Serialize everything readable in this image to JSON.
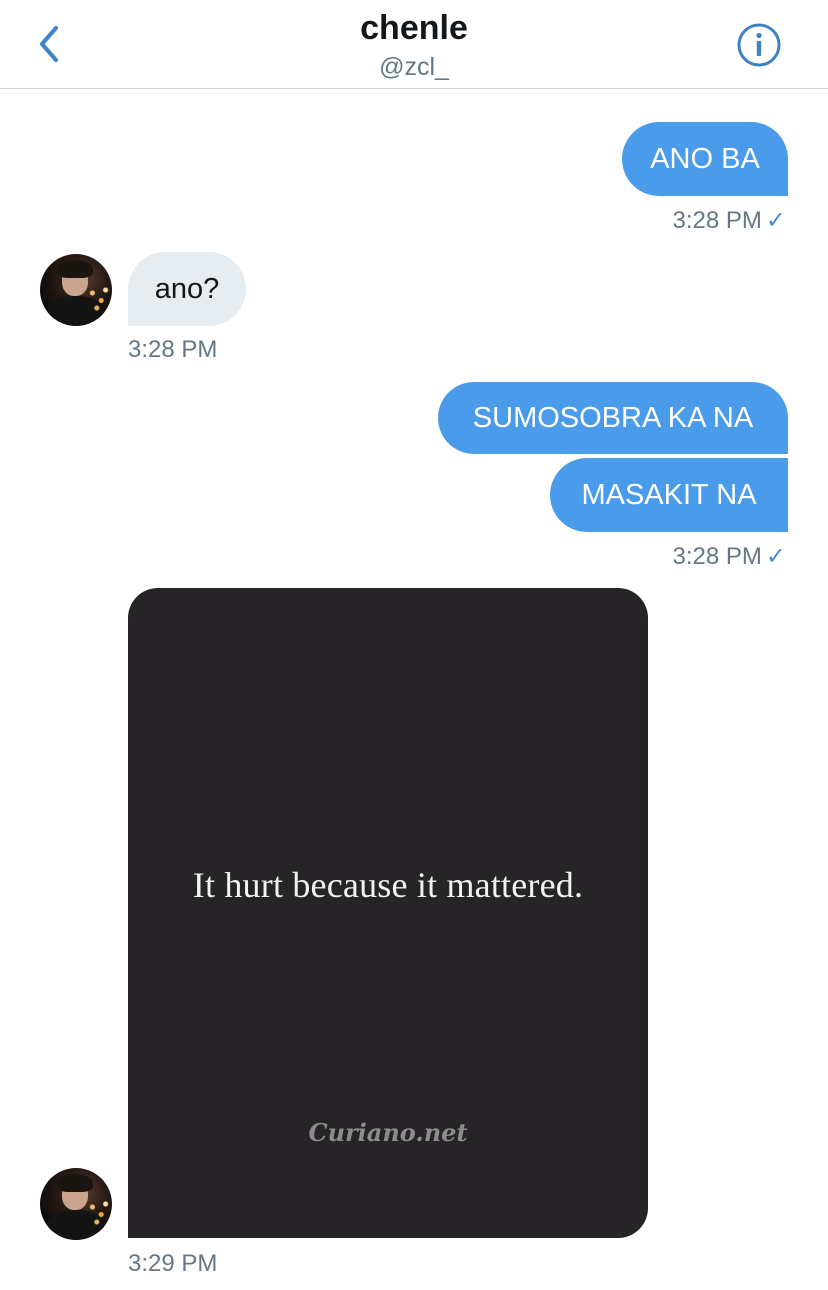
{
  "header": {
    "title": "chenle",
    "handle": "@zcl_",
    "back_icon": "chevron-left-icon",
    "info_icon": "info-icon",
    "accent_color": "#3f82c4"
  },
  "messages": [
    {
      "direction": "sent",
      "text": "ANO BA"
    },
    {
      "direction": "received",
      "text": "ano?"
    },
    {
      "direction": "sent",
      "text": "SUMOSOBRA KA NA"
    },
    {
      "direction": "sent",
      "text": "MASAKIT NA"
    }
  ],
  "timestamps": {
    "t1": "3:28 PM",
    "t2": "3:28 PM",
    "t3": "3:28 PM",
    "t4": "3:29 PM"
  },
  "read_mark": "✓",
  "media": {
    "quote": "It hurt because it mattered.",
    "watermark": "Curiano.net"
  },
  "colors": {
    "sent_bubble": "#4a9ceb",
    "received_bubble": "#e6ecf0",
    "meta_text": "#657786",
    "media_background": "#262426"
  }
}
